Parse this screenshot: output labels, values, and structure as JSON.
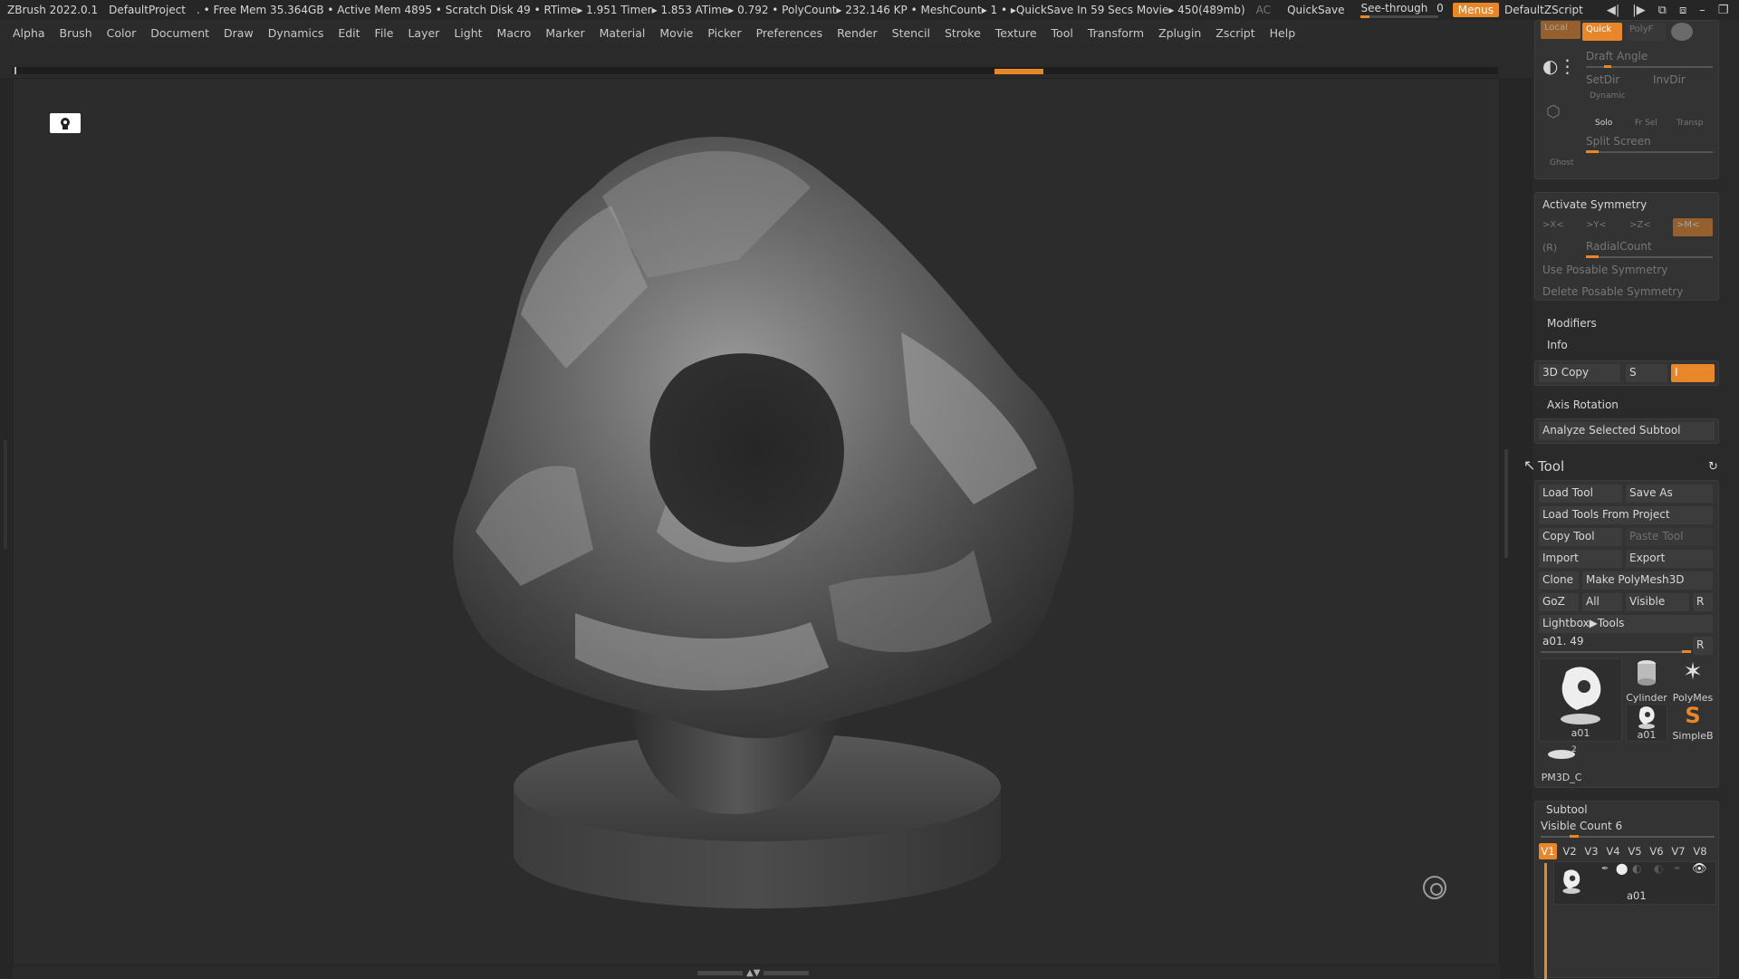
{
  "status": {
    "app": "ZBrush 2022.0.1",
    "project": "DefaultProject",
    "stats": ". • Free Mem 35.364GB • Active Mem 4895 • Scratch Disk 49 • RTime▸ 1.951 Timer▸ 1.853 ATime▸ 0.792 • PolyCount▸ 232.146 KP • MeshCount▸ 1 • ▸QuickSave In 59 Secs Movie▸ 450(489mb)",
    "ac": "AC",
    "quicksave": "QuickSave",
    "seethrough_label": "See-through",
    "seethrough_value": "0",
    "menus": "Menus",
    "zscript": "DefaultZScript"
  },
  "menubar": [
    "Alpha",
    "Brush",
    "Color",
    "Document",
    "Draw",
    "Dynamics",
    "Edit",
    "File",
    "Layer",
    "Light",
    "Macro",
    "Marker",
    "Material",
    "Movie",
    "Picker",
    "Preferences",
    "Render",
    "Stencil",
    "Stroke",
    "Texture",
    "Tool",
    "Transform",
    "Zplugin",
    "Zscript",
    "Help"
  ],
  "viewtop": {
    "local": "Local",
    "quick": "Quick",
    "polyf": "PolyF",
    "draft_angle": "Draft Angle",
    "setdir": "SetDir",
    "invdir": "InvDir",
    "dynamic": "Dynamic",
    "solo": "Solo",
    "frsel": "Fr Sel",
    "transp": "Transp",
    "split_screen": "Split Screen",
    "ghost": "Ghost"
  },
  "symmetry": {
    "activate": "Activate Symmetry",
    "x": ">X<",
    "y": ">Y<",
    "z": ">Z<",
    "m": ">M<",
    "r": "(R)",
    "radial": "RadialCount",
    "use_posable": "Use Posable Symmetry",
    "delete_posable": "Delete Posable Symmetry"
  },
  "mods": {
    "modifiers": "Modifiers",
    "info": "Info",
    "copy3d": "3D Copy",
    "s": "S",
    "i": "I",
    "axis_rotation": "Axis Rotation",
    "analyze": "Analyze Selected Subtool"
  },
  "tool": {
    "title": "Tool",
    "load_tool": "Load Tool",
    "save_as": "Save As",
    "load_from_project": "Load Tools From Project",
    "copy_tool": "Copy Tool",
    "paste_tool": "Paste Tool",
    "import": "Import",
    "export": "Export",
    "clone": "Clone",
    "make_polymesh": "Make PolyMesh3D",
    "goz": "GoZ",
    "all": "All",
    "visible": "Visible",
    "r": "R",
    "lightbox_tools": "Lightbox▶Tools",
    "current": "a01. 49",
    "current_r": "R",
    "thumbs": [
      "a01",
      "Cylinder",
      "PolyMes",
      "a01",
      "SimpleB"
    ],
    "thumb_small": "PM3D_C",
    "thumb_small_count": "2"
  },
  "subtool": {
    "title": "Subtool",
    "visible_count": "Visible Count 6",
    "versions": [
      "V1",
      "V2",
      "V3",
      "V4",
      "V5",
      "V6",
      "V7",
      "V8"
    ],
    "item_name": "a01"
  },
  "colors": {
    "accent": "#e8862a",
    "bg": "#2c2c2c",
    "panel": "#333333"
  }
}
